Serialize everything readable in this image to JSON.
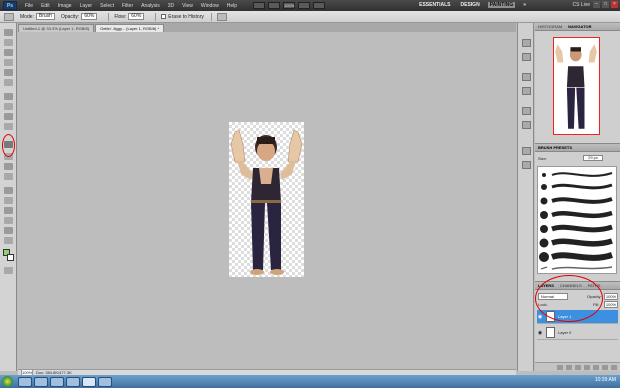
{
  "app": {
    "logo": "Ps"
  },
  "menu": [
    "File",
    "Edit",
    "Image",
    "Layer",
    "Select",
    "Filter",
    "Analysis",
    "3D",
    "View",
    "Window",
    "Help"
  ],
  "appbar_zoom": "100%",
  "workspaces": {
    "essentials": "ESSENTIALS",
    "design": "DESIGN",
    "painting": "PAINTING",
    "more": "»"
  },
  "cs_live": "CS Live",
  "options": {
    "mode_label": "Mode:",
    "mode_value": "Brush",
    "opacity_label": "Opacity:",
    "opacity_value": "60%",
    "flow_label": "Flow:",
    "flow_value": "60%",
    "erase_history": "Erase to History"
  },
  "tabs": [
    "Untitled-1 @ 33.3% (Layer 1, RGB/8)",
    "Gettin' Jiggy... (Layer 1, RGB/8) *"
  ],
  "status": {
    "zoom": "100%",
    "doc": "Doc: 284.8K/477.3K"
  },
  "panels": {
    "navigator_tabs": [
      "HISTOGRAM",
      "NAVIGATOR"
    ],
    "brush_presets_title": "BRUSH PRESETS",
    "brush_size_label": "Size:",
    "brush_size_value": "29 px",
    "layers_tabs": [
      "LAYERS",
      "CHANNELS",
      "PATHS"
    ],
    "blend_mode": "Normal",
    "opacity_label": "Opacity:",
    "opacity_value": "100%",
    "lock_label": "Lock:",
    "fill_label": "Fill:",
    "fill_value": "100%",
    "layers": [
      {
        "name": "Layer 1",
        "selected": true
      },
      {
        "name": "Layer 0",
        "selected": false
      }
    ]
  },
  "taskbar": {
    "time": "10:39 AM"
  },
  "colors": {
    "foreground": "#8ed36e",
    "background": "#ffffff",
    "selection": "#3d8fe0",
    "annotation": "#e10000"
  }
}
